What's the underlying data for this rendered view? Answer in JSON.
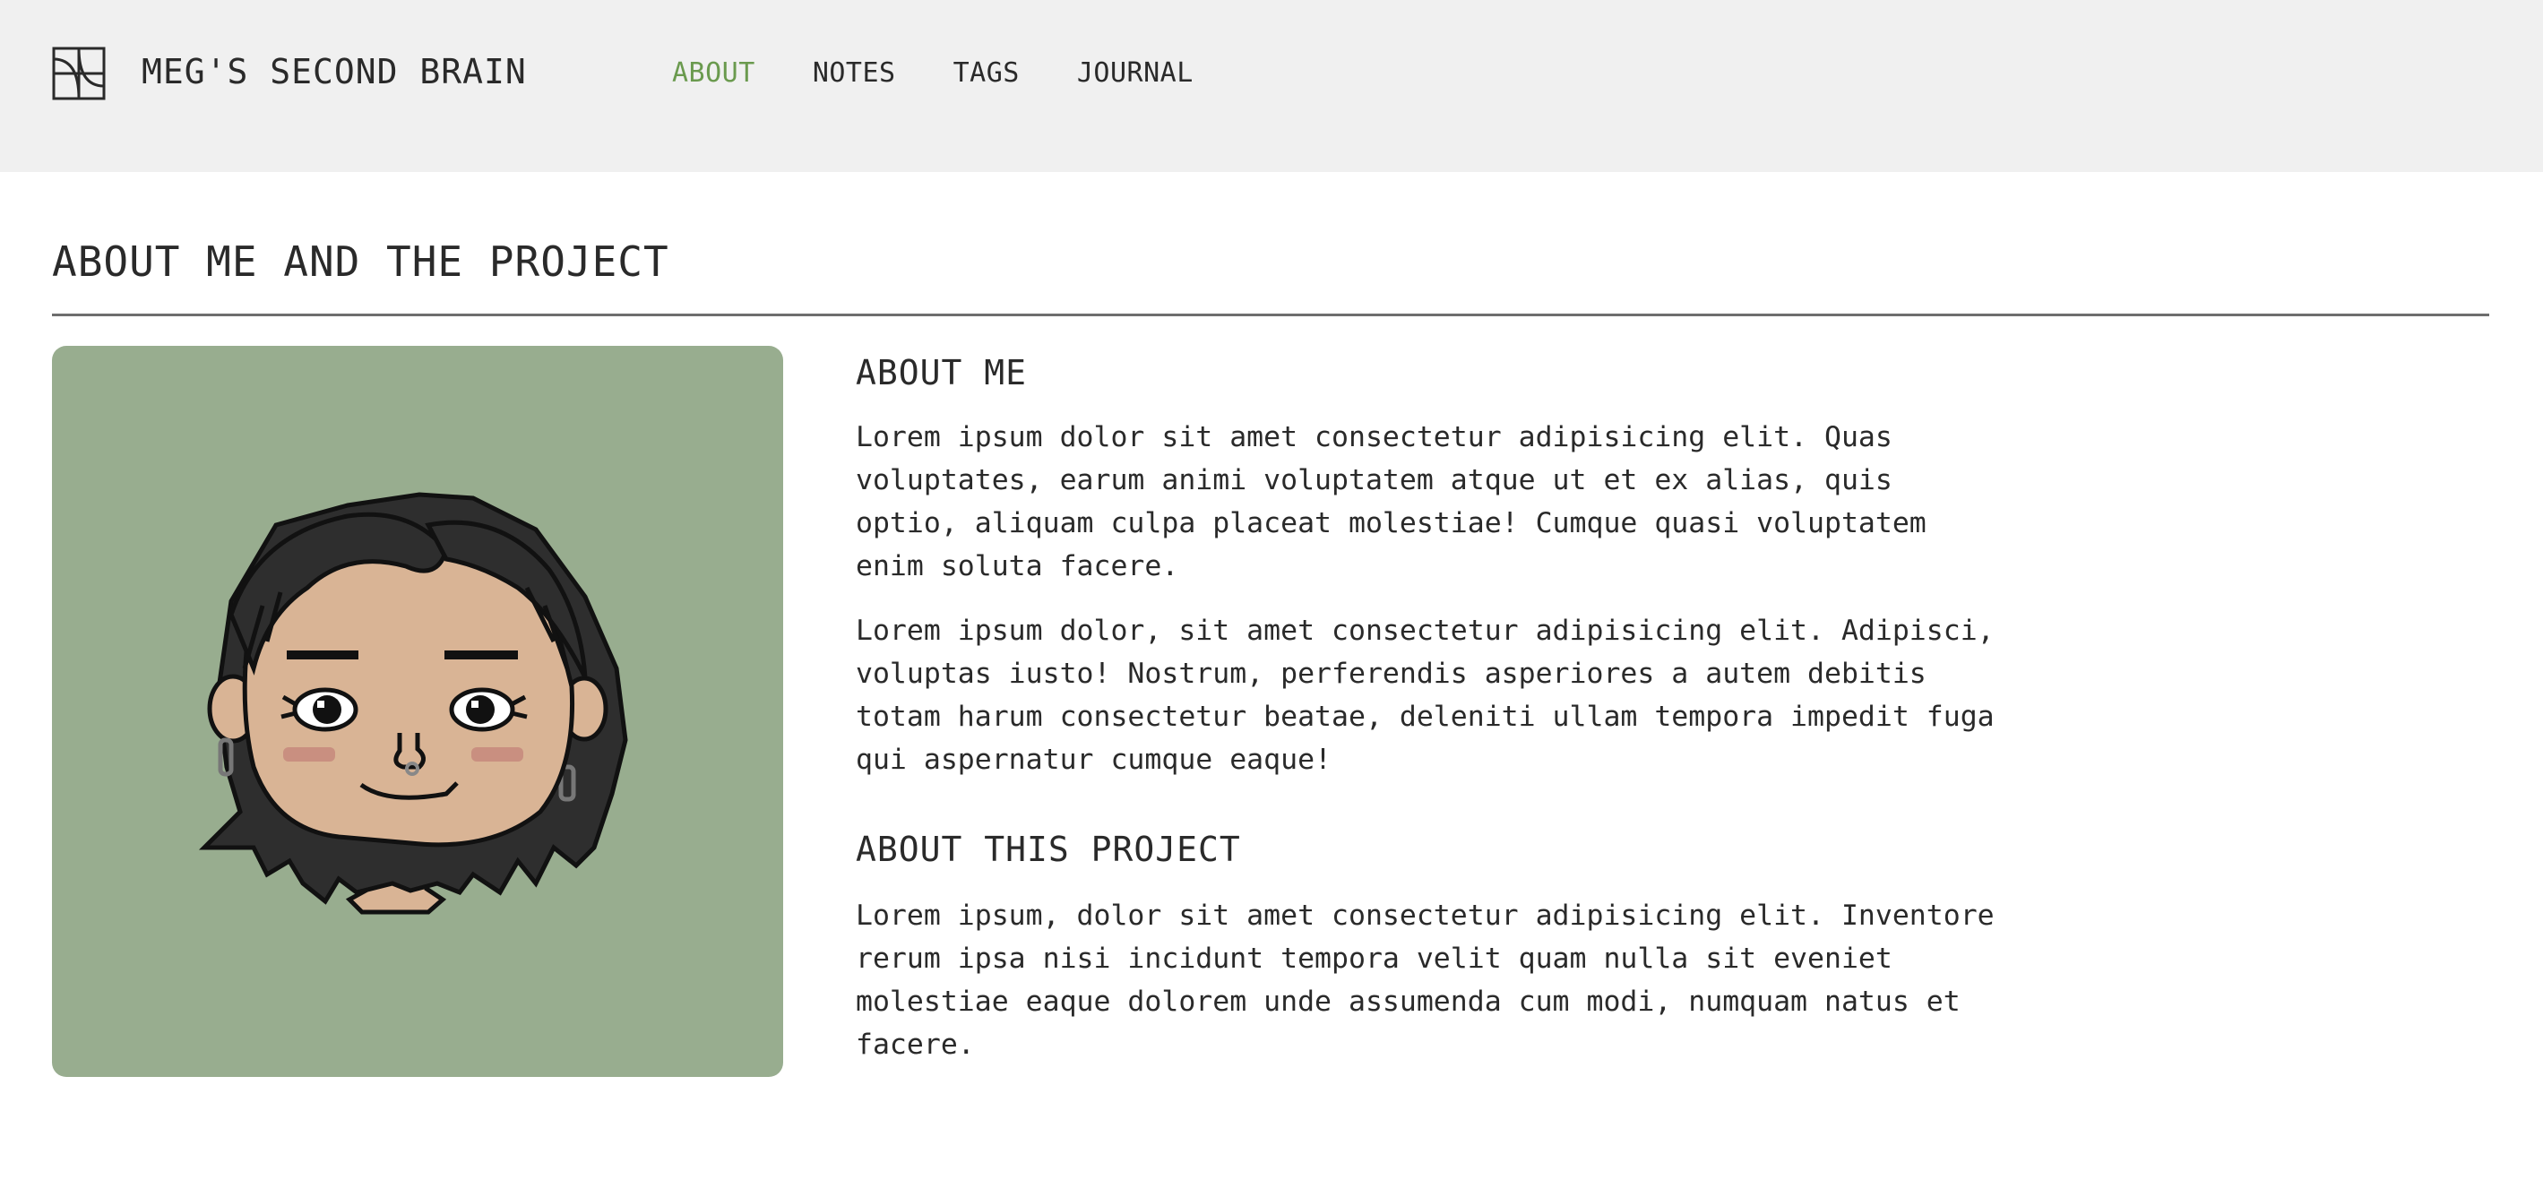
{
  "header": {
    "site_title": "MEG'S SECOND BRAIN",
    "logo_icon": "square-curves-logo-icon",
    "nav": [
      {
        "label": "ABOUT",
        "active": true
      },
      {
        "label": "NOTES",
        "active": false
      },
      {
        "label": "TAGS",
        "active": false
      },
      {
        "label": "JOURNAL",
        "active": false
      }
    ]
  },
  "page": {
    "title": "ABOUT ME AND THE PROJECT"
  },
  "about_me": {
    "heading": "ABOUT ME",
    "paragraphs": [
      "Lorem ipsum dolor sit amet consectetur adipisicing elit. Quas voluptates, earum animi voluptatem atque ut et ex alias, quis optio, aliquam culpa placeat molestiae! Cumque quasi voluptatem enim soluta facere.",
      "Lorem ipsum dolor, sit amet consectetur adipisicing elit. Adipisci, voluptas iusto! Nostrum, perferendis asperiores a autem debitis totam harum consectetur beatae, deleniti ullam tempora impedit fuga qui aspernatur cumque eaque!"
    ]
  },
  "about_project": {
    "heading": "ABOUT THIS PROJECT",
    "paragraphs": [
      "Lorem ipsum, dolor sit amet consectetur adipisicing elit. Inventore rerum ipsa nisi incidunt tempora velit quam nulla sit eveniet molestiae eaque dolorem unde assumenda cum modi, numquam natus et facere."
    ]
  },
  "colors": {
    "accent": "#6a9a4e",
    "header_bg": "#f0f0f0",
    "avatar_bg": "#98ad8f",
    "text": "#2a2a2a"
  }
}
